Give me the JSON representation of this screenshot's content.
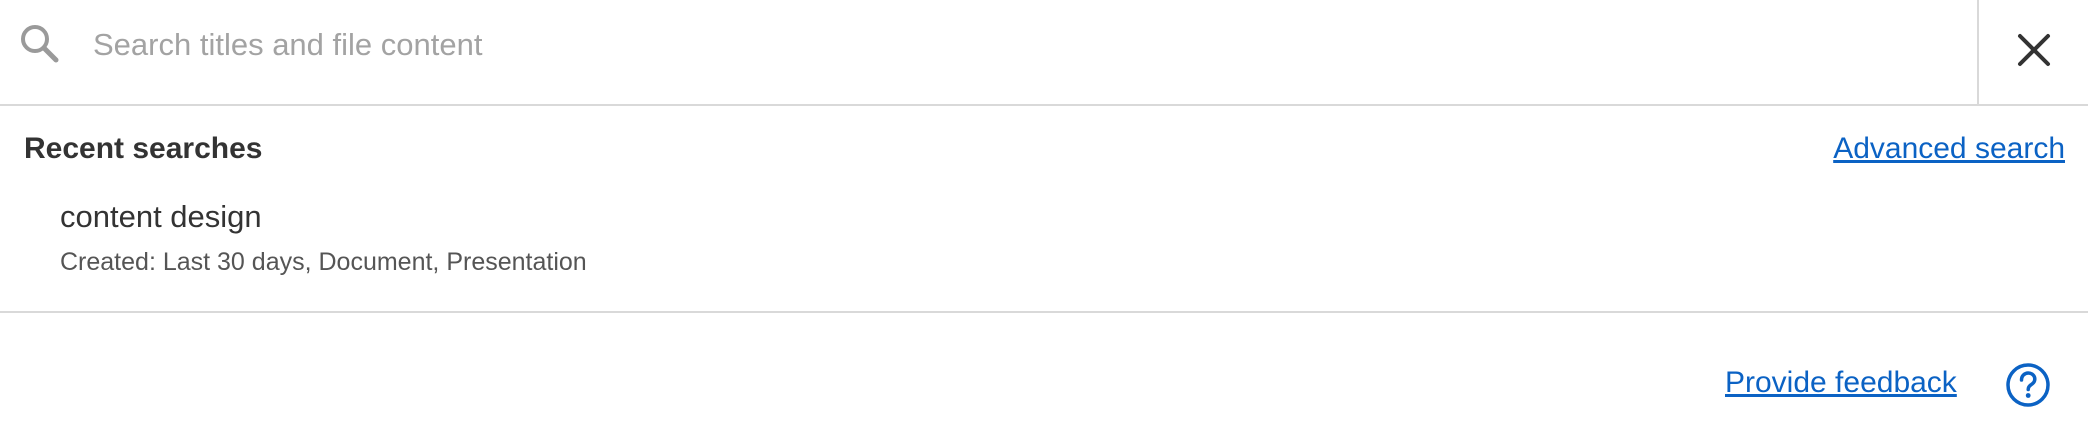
{
  "search": {
    "placeholder": "Search titles and file content",
    "value": ""
  },
  "recent": {
    "heading": "Recent searches",
    "advanced_label": "Advanced search",
    "items": [
      {
        "query": "content design",
        "filters": "Created: Last 30 days, Document, Presentation"
      }
    ]
  },
  "footer": {
    "feedback_label": "Provide feedback"
  },
  "colors": {
    "link": "#0b62c4",
    "text": "#333333",
    "placeholder": "#a3a3a3",
    "divider": "#d9d9d9"
  },
  "icons": {
    "search": "search-icon",
    "close": "close-icon",
    "help": "help-circle-icon"
  }
}
